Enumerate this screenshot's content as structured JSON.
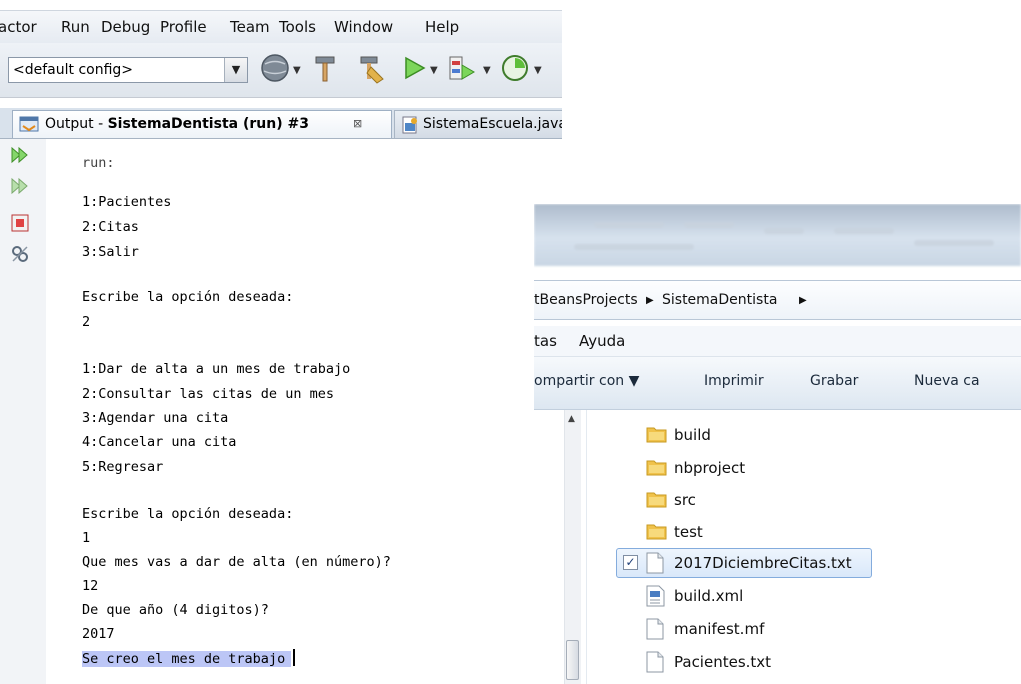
{
  "netbeans": {
    "menu": [
      "actor",
      "Run",
      "Debug",
      "Profile",
      "Team",
      "Tools",
      "Window",
      "Help"
    ],
    "config_value": "<default config>",
    "output_tab": {
      "prefix": "Output - ",
      "project": "SistemaDentista (run) #3",
      "close": "⊠"
    },
    "editor_tab": "SistemaEscuela.java",
    "console_lines": [
      "run:",
      "1:Pacientes",
      "2:Citas",
      "3:Salir",
      "Escribe la opción deseada:",
      "2",
      "1:Dar de alta a un mes de trabajo",
      "2:Consultar las citas de un mes",
      "3:Agendar una cita",
      "4:Cancelar una cita",
      "5:Regresar",
      "Escribe la opción deseada:",
      "1",
      "Que mes vas a dar de alta (en número)?",
      "12",
      "De que año (4 digitos)?",
      "2017"
    ],
    "console_last_line": "Se creo el mes de trabajo"
  },
  "explorer": {
    "breadcrumb": [
      "tBeansProjects",
      "SistemaDentista"
    ],
    "menu": [
      "tas",
      "Ayuda"
    ],
    "commands": [
      "ompartir con ▼",
      "Imprimir",
      "Grabar",
      "Nueva ca"
    ],
    "items": [
      {
        "name": "build",
        "type": "folder"
      },
      {
        "name": "nbproject",
        "type": "folder"
      },
      {
        "name": "src",
        "type": "folder"
      },
      {
        "name": "test",
        "type": "folder"
      },
      {
        "name": "2017DiciembreCitas.txt",
        "type": "txt",
        "selected": true
      },
      {
        "name": "build.xml",
        "type": "xml"
      },
      {
        "name": "manifest.mf",
        "type": "file"
      },
      {
        "name": "Pacientes.txt",
        "type": "txt"
      }
    ]
  },
  "colors": {
    "highlight": "#bcc6f6",
    "selection": "#d9e8fa",
    "folder": "#f0c24b"
  }
}
